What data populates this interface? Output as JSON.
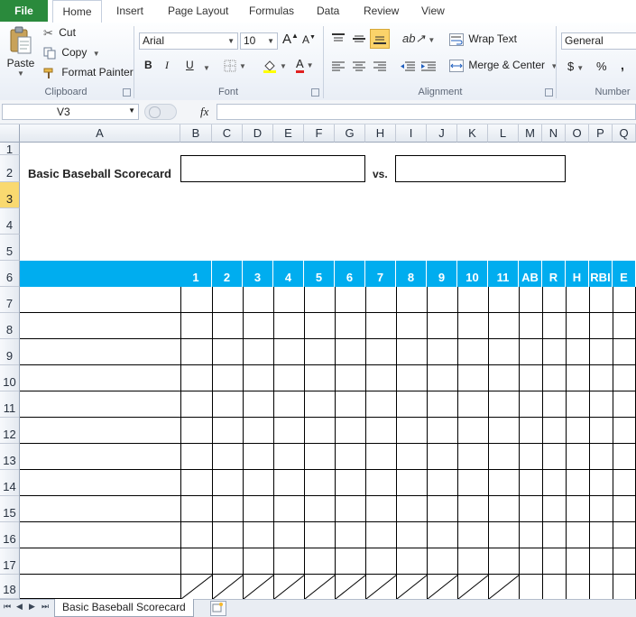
{
  "tabs": {
    "file": "File",
    "items": [
      "Home",
      "Insert",
      "Page Layout",
      "Formulas",
      "Data",
      "Review",
      "View"
    ]
  },
  "clipboard": {
    "paste": "Paste",
    "cut": "Cut",
    "copy": "Copy",
    "format_painter": "Format Painter",
    "label": "Clipboard"
  },
  "font": {
    "name": "Arial",
    "size": "10",
    "bold": "B",
    "italic": "I",
    "underline": "U",
    "grow": "A",
    "shrink": "A",
    "color": "A",
    "label": "Font"
  },
  "alignment": {
    "wrap_text": "Wrap Text",
    "merge_center": "Merge & Center",
    "label": "Alignment"
  },
  "number": {
    "format": "General",
    "currency": "$",
    "percent": "%",
    "comma": ",",
    "label": "Number"
  },
  "formula_bar": {
    "name_box": "V3",
    "fx": "fx",
    "value": ""
  },
  "columns": [
    "A",
    "B",
    "C",
    "D",
    "E",
    "F",
    "G",
    "H",
    "I",
    "J",
    "K",
    "L",
    "M",
    "N",
    "O",
    "P",
    "Q"
  ],
  "rows": [
    "1",
    "2",
    "3",
    "4",
    "5",
    "6",
    "7",
    "8",
    "9",
    "10",
    "11",
    "12",
    "13",
    "14",
    "15",
    "16",
    "17",
    "18"
  ],
  "sheet": {
    "title": "Basic Baseball Scorecard",
    "vs": "vs.",
    "team1": "",
    "team2": "",
    "inning_headers": [
      "1",
      "2",
      "3",
      "4",
      "5",
      "6",
      "7",
      "8",
      "9",
      "10",
      "11"
    ],
    "stat_headers": [
      "AB",
      "R",
      "H",
      "RBI",
      "E"
    ],
    "tab_name": "Basic Baseball Scorecard"
  },
  "colors": {
    "header_fill": "#00adef",
    "file_tab": "#2a8a3c",
    "selected_row": "#f9d970"
  }
}
